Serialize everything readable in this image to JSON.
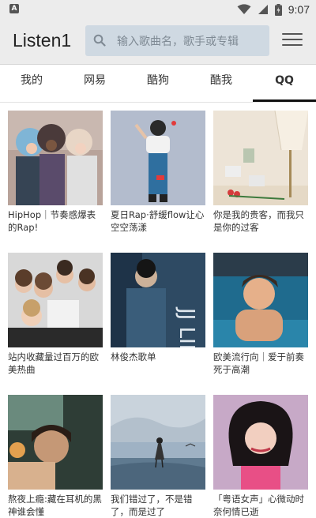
{
  "status_bar": {
    "time": "9:07",
    "icons": [
      "app-notification-icon",
      "wifi-icon",
      "battery-icon"
    ]
  },
  "app_bar": {
    "title": "Listen1",
    "search_placeholder": "输入歌曲名，歌手或专辑",
    "icons": [
      "search-icon",
      "menu-icon"
    ]
  },
  "tabs": {
    "items": [
      {
        "label": "我的",
        "active": false
      },
      {
        "label": "网易",
        "active": false
      },
      {
        "label": "酷狗",
        "active": false
      },
      {
        "label": "酷我",
        "active": false
      },
      {
        "label": "QQ",
        "active": true
      }
    ]
  },
  "playlists": [
    {
      "caption": "HipHop｜节奏感爆表的Rap!"
    },
    {
      "caption": "夏日Rap·舒缓flow让心空空荡漾"
    },
    {
      "caption": "你是我的贵客，而我只是你的过客"
    },
    {
      "caption": "站内收藏量过百万的欧美热曲"
    },
    {
      "caption": "林俊杰歌单"
    },
    {
      "caption": "欧美流行向｜爱于前奏死于高潮"
    },
    {
      "caption": "熬夜上瘾:藏在耳机的黑神谁会懂"
    },
    {
      "caption": "我们错过了，不是错了，而是过了"
    },
    {
      "caption": "「粤语女声」心微动时奈何情已逝"
    }
  ],
  "colors": {
    "app_bar_bg": "#ececec",
    "search_bg": "#cfd9e2",
    "active_tab_indicator": "#111111"
  }
}
